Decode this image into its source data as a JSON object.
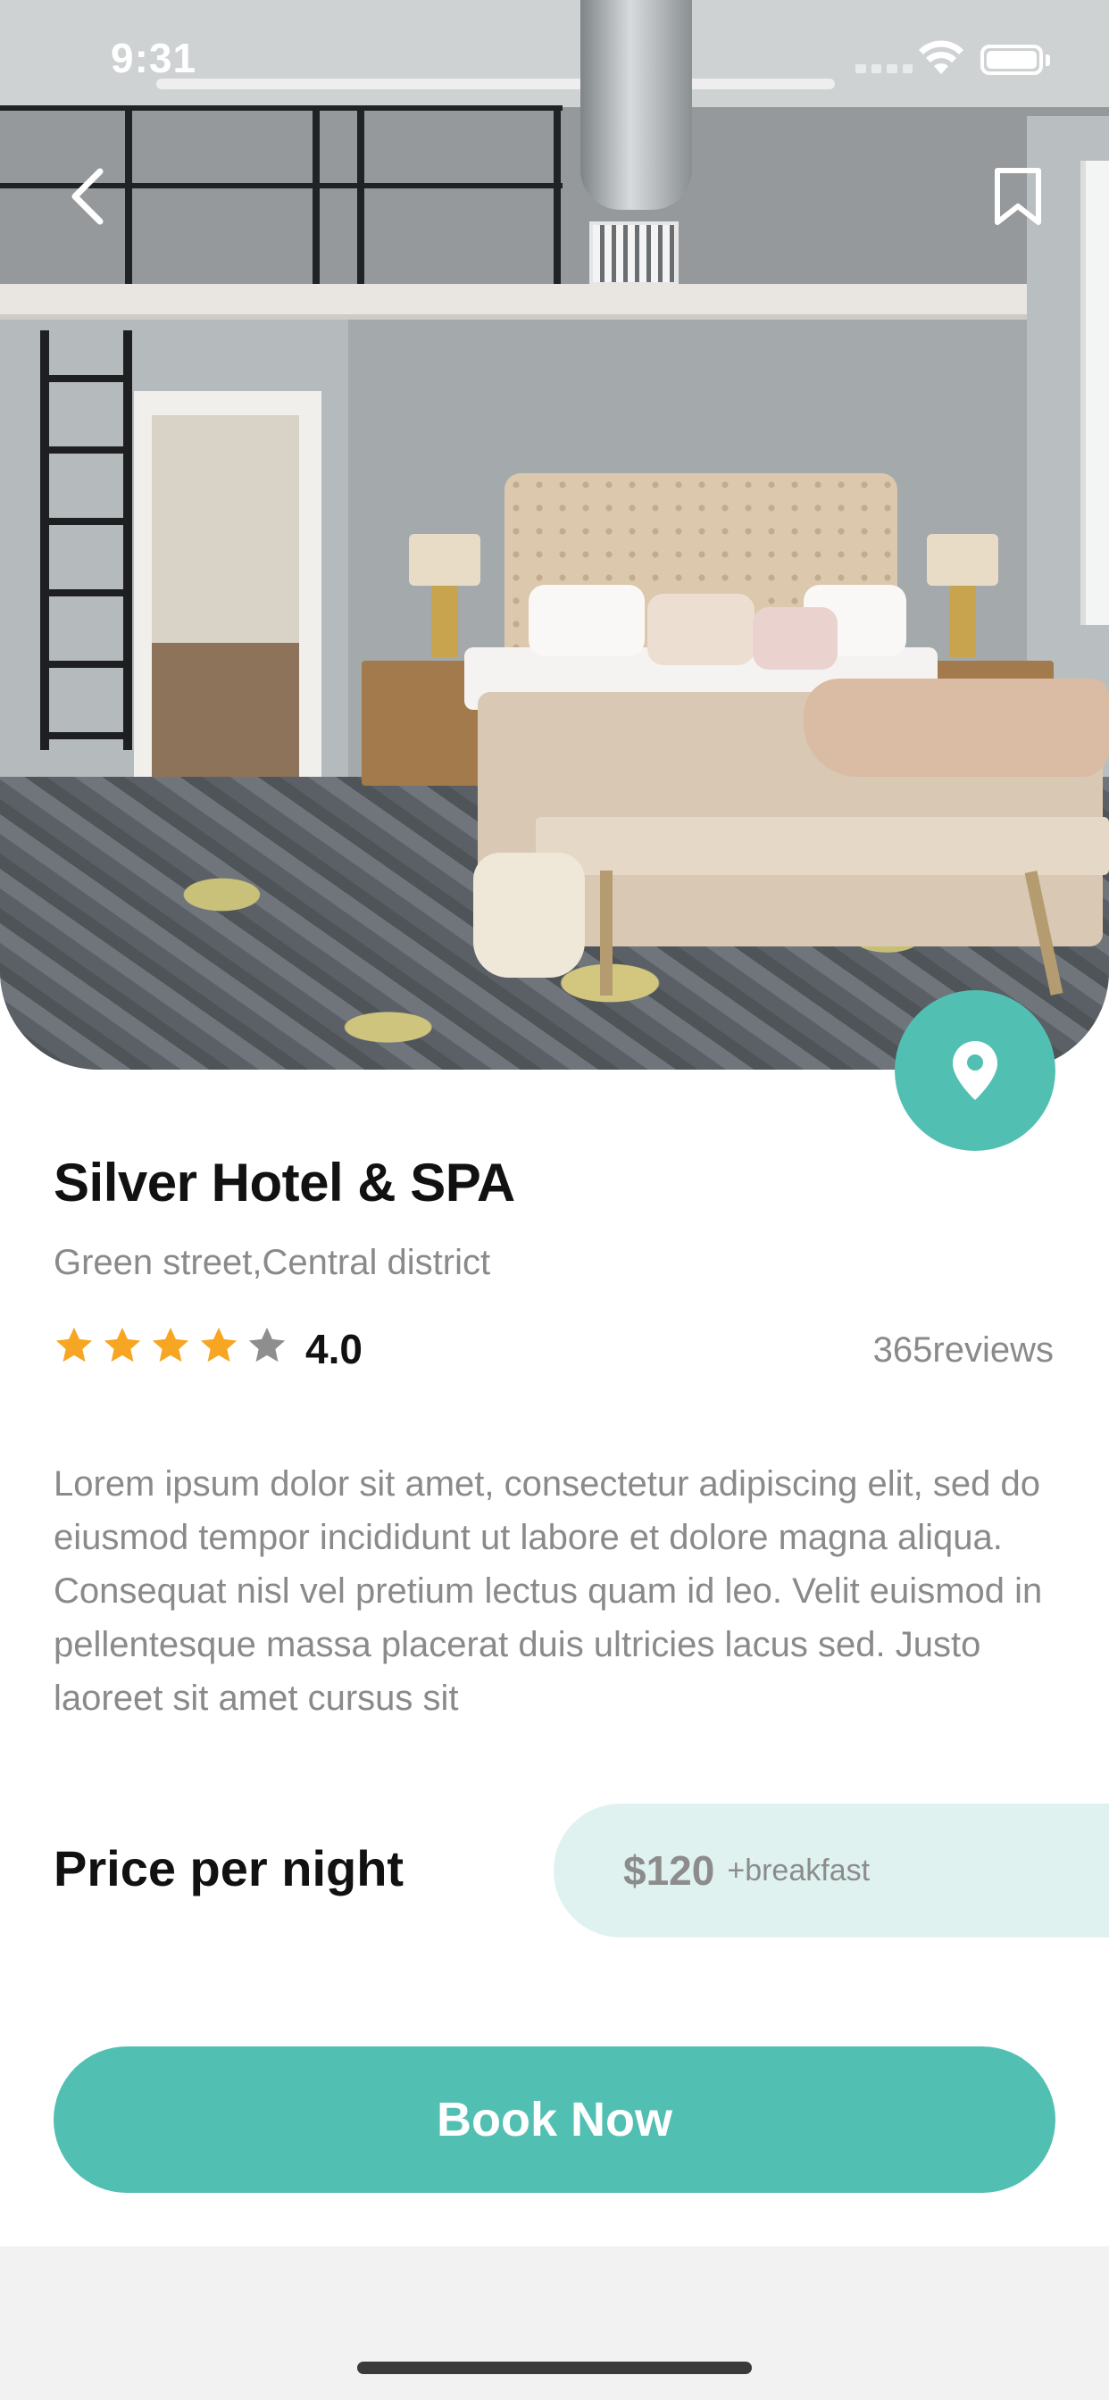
{
  "status_bar": {
    "time": "9:31"
  },
  "nav": {
    "back_icon": "chevron-left-icon",
    "bookmark_icon": "bookmark-icon"
  },
  "hotel": {
    "name": "Silver Hotel & SPA",
    "address": "Green street,Central district",
    "rating_value": "4.0",
    "rating_stars": 4,
    "rating_max": 5,
    "reviews": "365reviews",
    "description": "Lorem ipsum dolor sit amet, consectetur adipiscing elit, sed do eiusmod tempor incididunt ut labore et dolore magna aliqua. Consequat nisl vel pretium lectus quam id leo. Velit euismod in pellentesque massa placerat duis ultricies lacus sed. Justo laoreet sit amet cursus sit"
  },
  "pricing": {
    "label": "Price per night",
    "price": "$120",
    "note": "+breakfast"
  },
  "actions": {
    "book_label": "Book Now",
    "map_icon": "location-pin-icon"
  },
  "colors": {
    "accent": "#52bfb3",
    "price_pill_bg": "#dff2ef",
    "star_filled": "#f6a623",
    "star_empty": "#8e8e8e",
    "title_text": "#111111",
    "secondary_text": "#8a8a8a"
  }
}
